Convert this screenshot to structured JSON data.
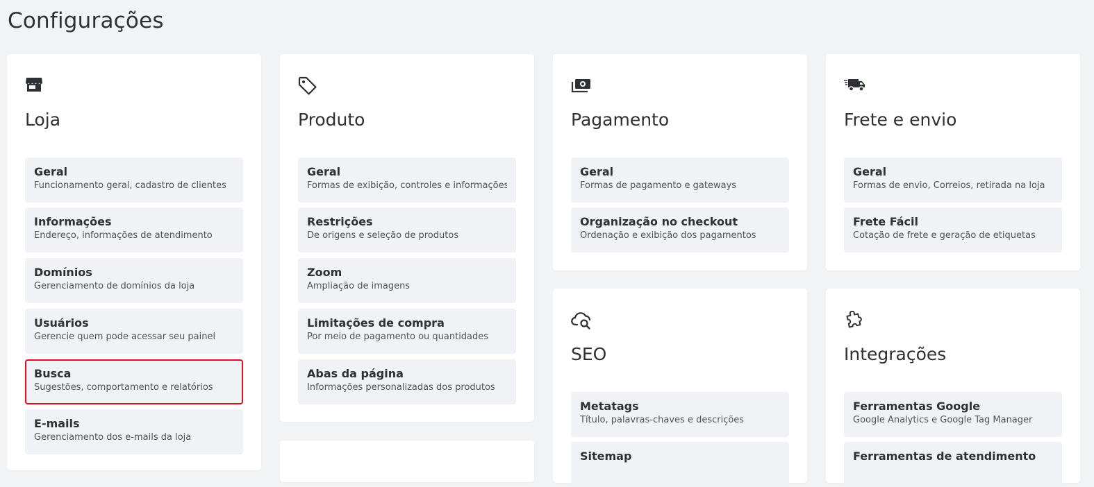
{
  "page": {
    "title": "Configurações"
  },
  "cards": {
    "loja": {
      "title": "Loja",
      "icon": "store-icon",
      "items": [
        {
          "title": "Geral",
          "desc": "Funcionamento geral, cadastro de clientes"
        },
        {
          "title": "Informações",
          "desc": "Endereço, informações de atendimento"
        },
        {
          "title": "Domínios",
          "desc": "Gerenciamento de domínios da loja"
        },
        {
          "title": "Usuários",
          "desc": "Gerencie quem pode acessar seu painel"
        },
        {
          "title": "Busca",
          "desc": "Sugestões, comportamento e relatórios"
        },
        {
          "title": "E-mails",
          "desc": "Gerenciamento dos e-mails da loja"
        }
      ]
    },
    "produto": {
      "title": "Produto",
      "icon": "tag-icon",
      "items": [
        {
          "title": "Geral",
          "desc": "Formas de exibição, controles e informações"
        },
        {
          "title": "Restrições",
          "desc": "De origens e seleção de produtos"
        },
        {
          "title": "Zoom",
          "desc": "Ampliação de imagens"
        },
        {
          "title": "Limitações de compra",
          "desc": "Por meio de pagamento ou quantidades"
        },
        {
          "title": "Abas da página",
          "desc": "Informações personalizadas dos produtos"
        }
      ]
    },
    "pagamento": {
      "title": "Pagamento",
      "icon": "money-icon",
      "items": [
        {
          "title": "Geral",
          "desc": "Formas de pagamento e gateways"
        },
        {
          "title": "Organização no checkout",
          "desc": "Ordenação e exibição dos pagamentos"
        }
      ]
    },
    "frete": {
      "title": "Frete e envio",
      "icon": "truck-icon",
      "items": [
        {
          "title": "Geral",
          "desc": "Formas de envio, Correios, retirada na loja"
        },
        {
          "title": "Frete Fácil",
          "desc": "Cotação de frete e geração de etiquetas"
        }
      ]
    },
    "seo": {
      "title": "SEO",
      "icon": "cloud-search-icon",
      "items": [
        {
          "title": "Metatags",
          "desc": "Título, palavras-chaves e descrições"
        },
        {
          "title": "Sitemap",
          "desc": ""
        }
      ]
    },
    "integracoes": {
      "title": "Integrações",
      "icon": "puzzle-icon",
      "items": [
        {
          "title": "Ferramentas Google",
          "desc": "Google Analytics e Google Tag Manager"
        },
        {
          "title": "Ferramentas de atendimento",
          "desc": ""
        }
      ]
    }
  }
}
